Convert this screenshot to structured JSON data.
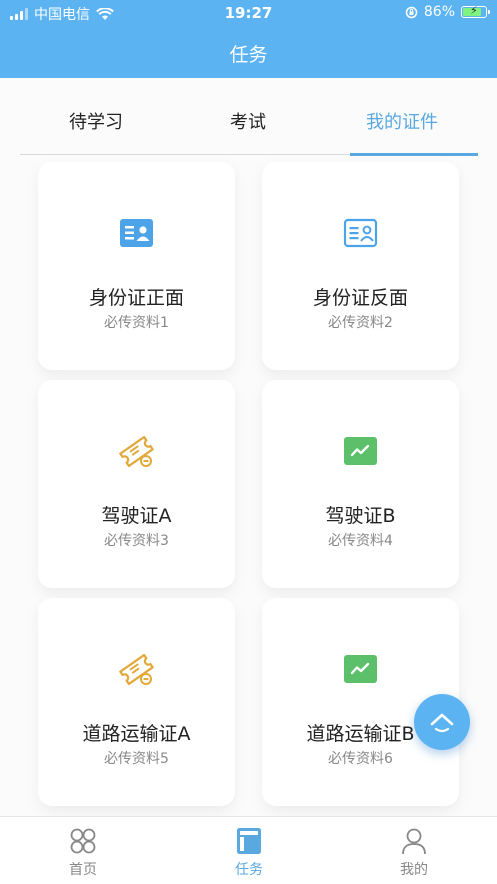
{
  "status_bar": {
    "carrier": "中国电信",
    "time": "19:27",
    "battery": "86%"
  },
  "header": {
    "title": "任务"
  },
  "tabs": [
    {
      "label": "待学习"
    },
    {
      "label": "考试"
    },
    {
      "label": "我的证件"
    }
  ],
  "cards": [
    {
      "name": "身份证正面",
      "sub": "必传资料1",
      "icon": "id-card-icon",
      "color": "#4da3e8"
    },
    {
      "name": "身份证反面",
      "sub": "必传资料2",
      "icon": "id-card-outline-icon",
      "color": "#4da3e8"
    },
    {
      "name": "驾驶证A",
      "sub": "必传资料3",
      "icon": "ticket-icon",
      "color": "#e2a93a"
    },
    {
      "name": "驾驶证B",
      "sub": "必传资料4",
      "icon": "chart-card-icon",
      "color": "#5cbf6a"
    },
    {
      "name": "道路运输证A",
      "sub": "必传资料5",
      "icon": "ticket-icon",
      "color": "#e2a93a"
    },
    {
      "name": "道路运输证B",
      "sub": "必传资料6",
      "icon": "chart-card-icon",
      "color": "#5cbf6a"
    }
  ],
  "bottom_nav": [
    {
      "label": "首页"
    },
    {
      "label": "任务"
    },
    {
      "label": "我的"
    }
  ],
  "colors": {
    "primary": "#5bb3f2",
    "accent": "#5aa8e0"
  }
}
